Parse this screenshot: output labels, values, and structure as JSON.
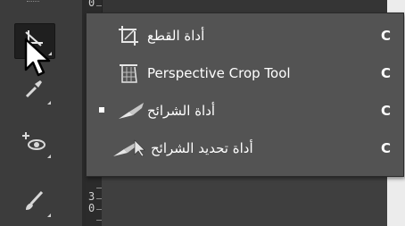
{
  "ruler": {
    "top_number": "0",
    "bottom_numbers": [
      "3",
      "0"
    ]
  },
  "toolbar": {
    "tools": [
      {
        "name": "crop",
        "icon": "crop-tool-icon",
        "active": true
      },
      {
        "name": "eyedropper",
        "icon": "eyedropper-icon",
        "active": false
      },
      {
        "name": "view-rotate",
        "icon": "eye-plus-icon",
        "active": false
      },
      {
        "name": "brush",
        "icon": "brush-icon",
        "active": false
      }
    ]
  },
  "flyout": {
    "items": [
      {
        "label": "أداة القطع",
        "shortcut": "C",
        "icon": "crop-icon",
        "selected": false
      },
      {
        "label": "Perspective Crop Tool",
        "shortcut": "C",
        "icon": "perspective-crop-icon",
        "selected": false
      },
      {
        "label": "أداة الشرائح",
        "shortcut": "C",
        "icon": "slice-icon",
        "selected": true
      },
      {
        "label": "أداة تحديد الشرائح",
        "shortcut": "C",
        "icon": "slice-select-icon",
        "selected": false
      }
    ]
  },
  "colors": {
    "toolbar_bg": "#3c3c3c",
    "flyout_bg": "#535353",
    "page_bg": "#ececec",
    "text": "#ffffff"
  }
}
